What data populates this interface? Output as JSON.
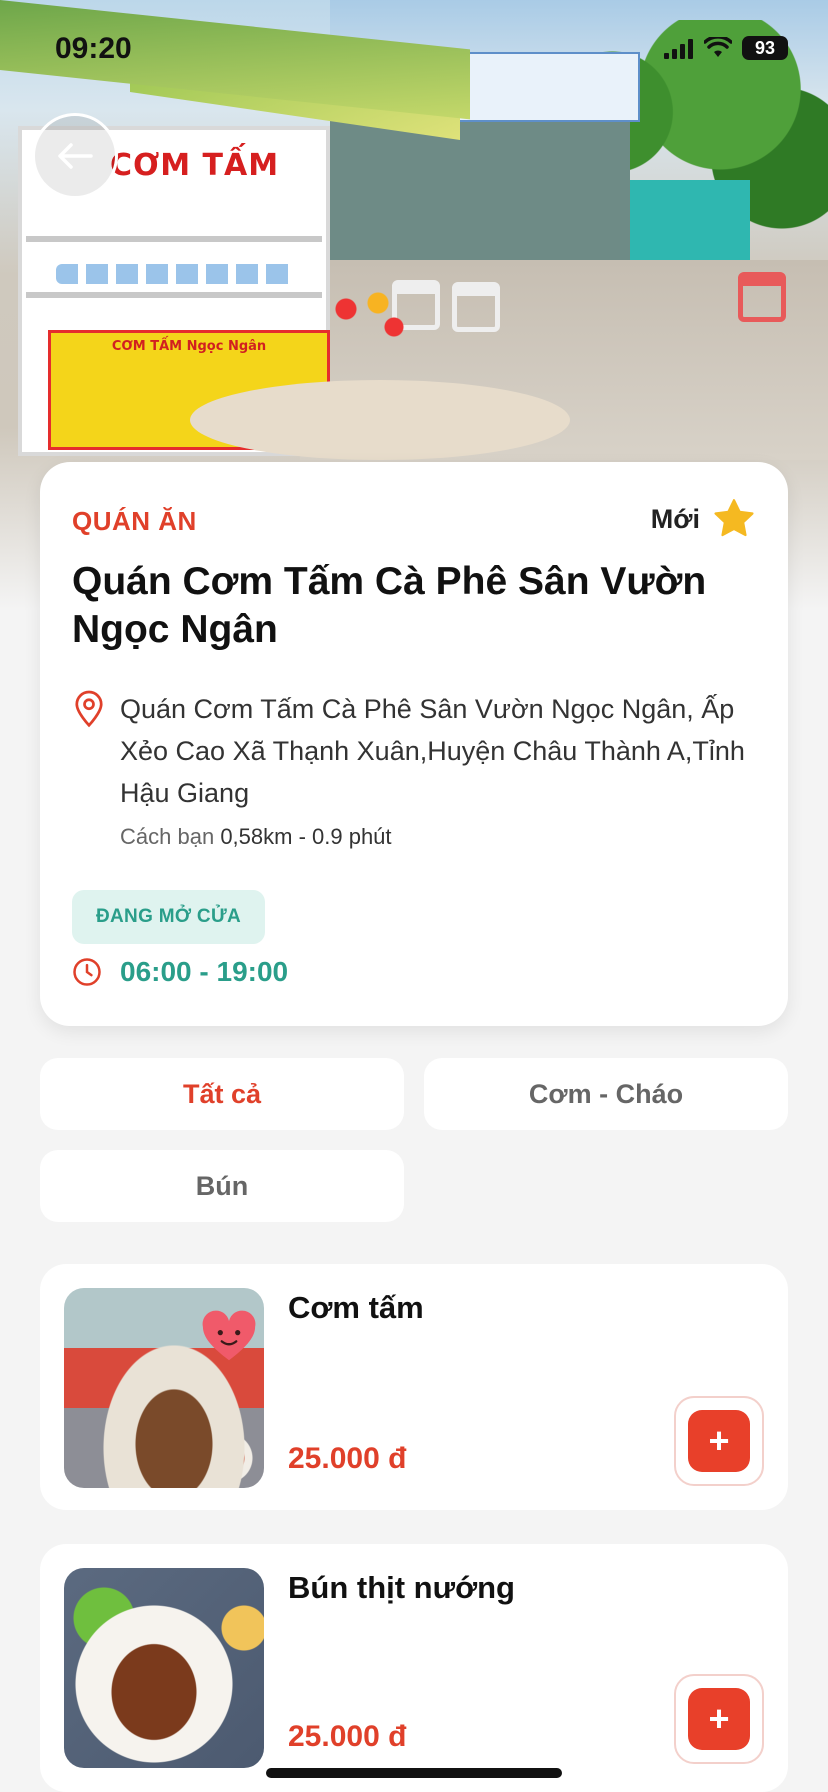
{
  "status_bar": {
    "time": "09:20",
    "battery": "93"
  },
  "store": {
    "category": "QUÁN ĂN",
    "badge": "Mới",
    "name": "Quán Cơm Tấm Cà Phê Sân Vườn Ngọc Ngân",
    "address": "Quán Cơm Tấm Cà Phê Sân Vườn Ngọc Ngân, Ấp Xẻo Cao Xã Thạnh Xuân,Huyện Châu Thành A,Tỉnh Hậu Giang",
    "distance_label": "Cách bạn",
    "distance_value": "0,58km - 0.9 phút",
    "open_status": "ĐANG MỞ CỬA",
    "hours": "06:00 - 19:00",
    "hero_sign": "CƠM TẤM",
    "hero_board": "CƠM TẤM Ngọc Ngân"
  },
  "filters": [
    {
      "label": "Tất cả",
      "active": true
    },
    {
      "label": "Cơm - Cháo",
      "active": false
    },
    {
      "label": "Bún",
      "active": false
    }
  ],
  "products": [
    {
      "name": "Cơm tấm",
      "price": "25.000 đ",
      "add_label": "+"
    },
    {
      "name": "Bún thịt nướng",
      "price": "25.000 đ",
      "add_label": "+"
    }
  ],
  "colors": {
    "accent": "#e0402a",
    "open_green": "#2a9e8a",
    "star": "#f5b921"
  },
  "icons": {
    "back": "arrow-left-icon",
    "star": "star-icon",
    "location": "location-pin-icon",
    "clock": "clock-icon",
    "add": "plus-icon"
  }
}
